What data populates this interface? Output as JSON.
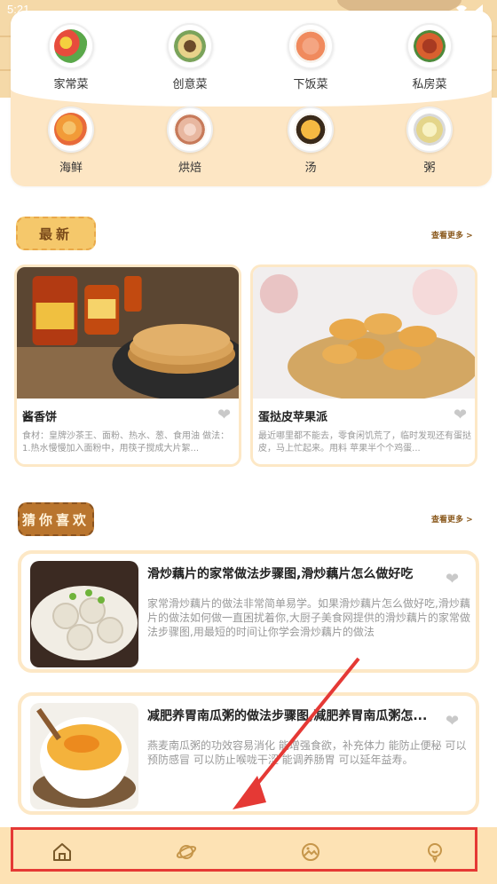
{
  "status": {
    "time": "5:21",
    "icons": "wifi-icon signal-icon"
  },
  "categories": [
    {
      "label": "家常菜",
      "icon": "home-dish-icon",
      "color": "#e9534a"
    },
    {
      "label": "创意菜",
      "icon": "creative-dish-icon",
      "color": "#d7b24a"
    },
    {
      "label": "下饭菜",
      "icon": "rice-dish-icon",
      "color": "#f08a5d"
    },
    {
      "label": "私房菜",
      "icon": "private-dish-icon",
      "color": "#c44a2c"
    },
    {
      "label": "海鲜",
      "icon": "seafood-icon",
      "color": "#f29b38"
    },
    {
      "label": "烘焙",
      "icon": "baking-icon",
      "color": "#e8b7a0"
    },
    {
      "label": "汤",
      "icon": "soup-icon",
      "color": "#e89a2c"
    },
    {
      "label": "粥",
      "icon": "porridge-icon",
      "color": "#f1e39a"
    }
  ],
  "latest": {
    "badge": "最新",
    "see_more": "查看更多 >",
    "items": [
      {
        "title": "酱香饼",
        "desc": "食材：皇牌沙茶王、面粉、热水、葱、食用油 做法：1.热水慢慢加入面粉中，用筷子搅成大片絮..."
      },
      {
        "title": "蛋挞皮苹果派",
        "desc": "最近哪里都不能去，零食闲饥荒了，临时发现还有蛋挞皮，马上忙起来。用料 苹果半个个鸡蛋..."
      }
    ]
  },
  "guess": {
    "badge": "猜你喜欢",
    "see_more": "查看更多 >",
    "items": [
      {
        "title": "滑炒藕片的家常做法步骤图,滑炒藕片怎么做好吃",
        "desc": "家常滑炒藕片的做法非常简单易学。如果滑炒藕片怎么做好吃,滑炒藕片的做法如何做一直困扰着你,大厨子美食网提供的滑炒藕片的家常做法步骤图,用最短的时间让你学会滑炒藕片的做法"
      },
      {
        "title": "减肥养胃南瓜粥的做法步骤图,减肥养胃南瓜粥怎...",
        "desc": "燕麦南瓜粥的功效容易消化 能增强食欲，补充体力 能防止便秘 可以预防感冒 可以防止喉咙干涩 能调养肠胃 可以延年益寿。"
      }
    ]
  },
  "nav": [
    {
      "name": "home",
      "icon": "home-icon"
    },
    {
      "name": "discover",
      "icon": "planet-icon"
    },
    {
      "name": "gallery",
      "icon": "image-icon"
    },
    {
      "name": "profile",
      "icon": "user-icon"
    }
  ]
}
